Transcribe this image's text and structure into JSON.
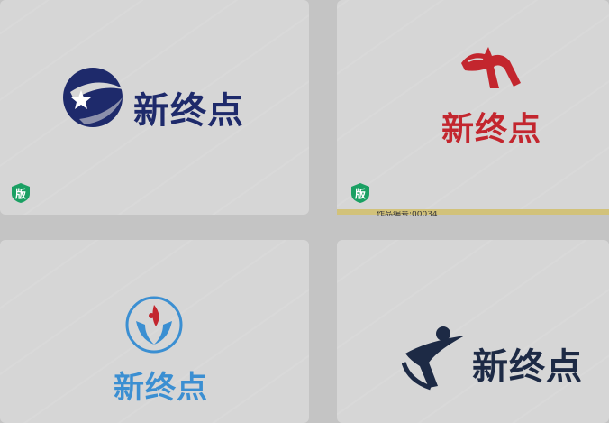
{
  "cards": [
    {
      "text": "新终点",
      "text_color": "#1e2a6b",
      "badge": "版",
      "badge_color": "#1aa063"
    },
    {
      "text": "新终点",
      "text_color": "#c3262e",
      "badge": "版",
      "badge_color": "#1aa063"
    },
    {
      "text": "新终点",
      "text_color": "#3b8fd2"
    },
    {
      "text": "新终点",
      "text_color": "#1d2a45"
    }
  ],
  "strip_text": "作品编号:00034"
}
